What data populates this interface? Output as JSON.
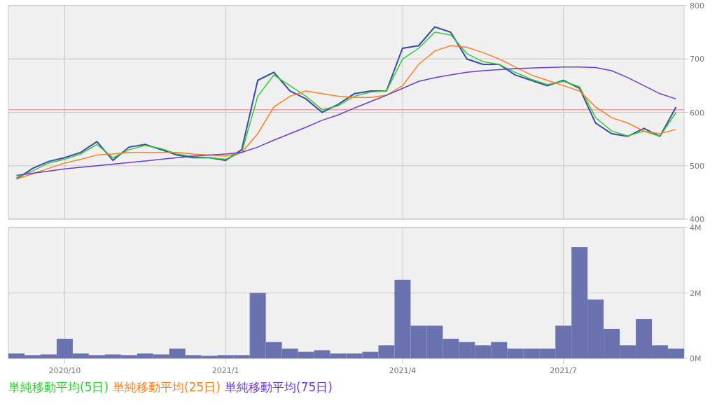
{
  "price_chart": {
    "chart_data": {
      "type": "line",
      "ylim": [
        400,
        800
      ],
      "categories": [
        null,
        null,
        null,
        null,
        null,
        null,
        null,
        null,
        null,
        null,
        null,
        null,
        null,
        null,
        null,
        null,
        null,
        null,
        null,
        null,
        null,
        null,
        null,
        null,
        null,
        null,
        null,
        null,
        null,
        null,
        null,
        null,
        null,
        null,
        null,
        null,
        null,
        null,
        null,
        null,
        null,
        null
      ],
      "yticks": [
        {
          "value": 400,
          "label": "400"
        },
        {
          "value": 500,
          "label": "500"
        },
        {
          "value": 600,
          "label": "600"
        },
        {
          "value": 700,
          "label": "700"
        },
        {
          "value": 800,
          "label": "800"
        }
      ],
      "series": [
        {
          "color": "#3a4aa8",
          "values": [
            475,
            495,
            508,
            515,
            525,
            545,
            510,
            535,
            540,
            530,
            520,
            515,
            515,
            510,
            530,
            660,
            675,
            640,
            625,
            600,
            615,
            635,
            640,
            640,
            720,
            725,
            760,
            750,
            700,
            690,
            690,
            670,
            660,
            650,
            660,
            645,
            580,
            560,
            555,
            570,
            555,
            610
          ]
        },
        {
          "name": "単純移動平均(5日)",
          "color": "#33cc33",
          "values": [
            478,
            490,
            505,
            512,
            522,
            540,
            515,
            530,
            538,
            532,
            522,
            517,
            515,
            512,
            525,
            630,
            670,
            650,
            630,
            605,
            612,
            630,
            638,
            640,
            700,
            720,
            750,
            745,
            710,
            695,
            690,
            675,
            662,
            652,
            658,
            648,
            590,
            565,
            556,
            565,
            555,
            600
          ]
        },
        {
          "name": "単純移動平均(25日)",
          "color": "#ff7f1e",
          "values": [
            475,
            485,
            495,
            505,
            512,
            520,
            522,
            525,
            525,
            525,
            525,
            522,
            520,
            518,
            525,
            560,
            610,
            630,
            640,
            635,
            630,
            628,
            628,
            632,
            650,
            690,
            715,
            725,
            722,
            712,
            700,
            685,
            670,
            660,
            650,
            640,
            610,
            590,
            580,
            565,
            560,
            568
          ]
        },
        {
          "name": "単純移動平均(75日)",
          "color": "#6a3ad0",
          "values": [
            482,
            486,
            490,
            494,
            497,
            500,
            503,
            506,
            509,
            512,
            515,
            518,
            520,
            522,
            525,
            535,
            548,
            560,
            572,
            585,
            595,
            608,
            620,
            632,
            645,
            658,
            665,
            670,
            675,
            678,
            680,
            682,
            683,
            684,
            685,
            685,
            684,
            678,
            665,
            650,
            635,
            625
          ]
        }
      ],
      "grid": true,
      "ref_lines": [
        {
          "axis": "y",
          "value": 605,
          "color": "#f4a0a0"
        }
      ]
    }
  },
  "volume_chart": {
    "chart_data": {
      "type": "bar",
      "ylim": [
        0,
        4
      ],
      "grid": true,
      "categories": [
        null,
        null,
        null,
        "2020/10",
        null,
        null,
        null,
        null,
        null,
        null,
        null,
        null,
        null,
        "2021/1",
        null,
        null,
        null,
        null,
        null,
        null,
        null,
        null,
        null,
        null,
        "2021/4",
        null,
        null,
        null,
        null,
        null,
        null,
        null,
        null,
        null,
        "2021/7",
        null,
        null,
        null,
        null,
        null,
        null,
        null
      ],
      "yticks": [
        {
          "value": 0,
          "label": "0M"
        },
        {
          "value": 2,
          "label": "2M"
        },
        {
          "value": 4,
          "label": "4M"
        }
      ],
      "series": [
        {
          "color": "#6b72b0",
          "values": [
            0.15,
            0.1,
            0.12,
            0.6,
            0.15,
            0.1,
            0.12,
            0.1,
            0.15,
            0.12,
            0.3,
            0.1,
            0.08,
            0.1,
            0.1,
            2.0,
            0.5,
            0.3,
            0.2,
            0.25,
            0.15,
            0.15,
            0.2,
            0.4,
            2.4,
            1.0,
            1.0,
            0.6,
            0.5,
            0.4,
            0.5,
            0.3,
            0.3,
            0.3,
            1.0,
            3.4,
            1.8,
            0.9,
            0.4,
            1.2,
            0.4,
            0.3
          ]
        }
      ]
    }
  }
}
